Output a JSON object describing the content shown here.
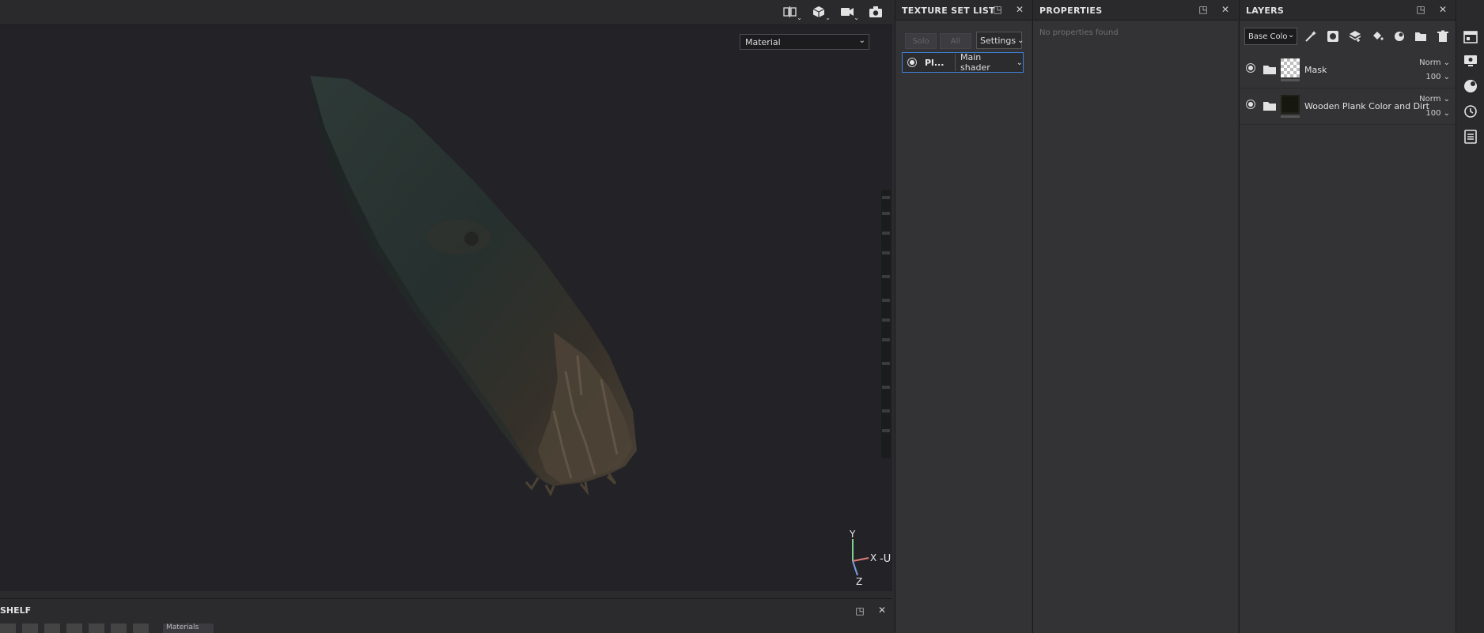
{
  "viewport": {
    "material_mode": "Material",
    "axis_labels": {
      "y": "Y",
      "x": "X",
      "z": "Z",
      "u": "-U"
    },
    "tools": [
      "split-view-icon",
      "cube-icon",
      "camera-video-icon",
      "screenshot-icon"
    ]
  },
  "shelf": {
    "title": "SHELF",
    "tab_label": "Materials"
  },
  "texture_set_list": {
    "title": "TEXTURE SET LIST",
    "solo_label": "Solo",
    "all_label": "All",
    "settings_label": "Settings",
    "texture_set": {
      "name": "Pl...",
      "shader": "Main shader"
    }
  },
  "properties": {
    "title": "PROPERTIES",
    "empty_text": "No properties found"
  },
  "layers": {
    "title": "LAYERS",
    "channel": "Base Colo",
    "items": [
      {
        "name": "Mask",
        "blend": "Norm",
        "opacity": "100"
      },
      {
        "name": "Wooden Plank Color and Dirt",
        "blend": "Norm",
        "opacity": "100"
      }
    ]
  },
  "colors": {
    "accent": "#3d7fd6",
    "panel": "#333336",
    "viewport": "#232327"
  }
}
